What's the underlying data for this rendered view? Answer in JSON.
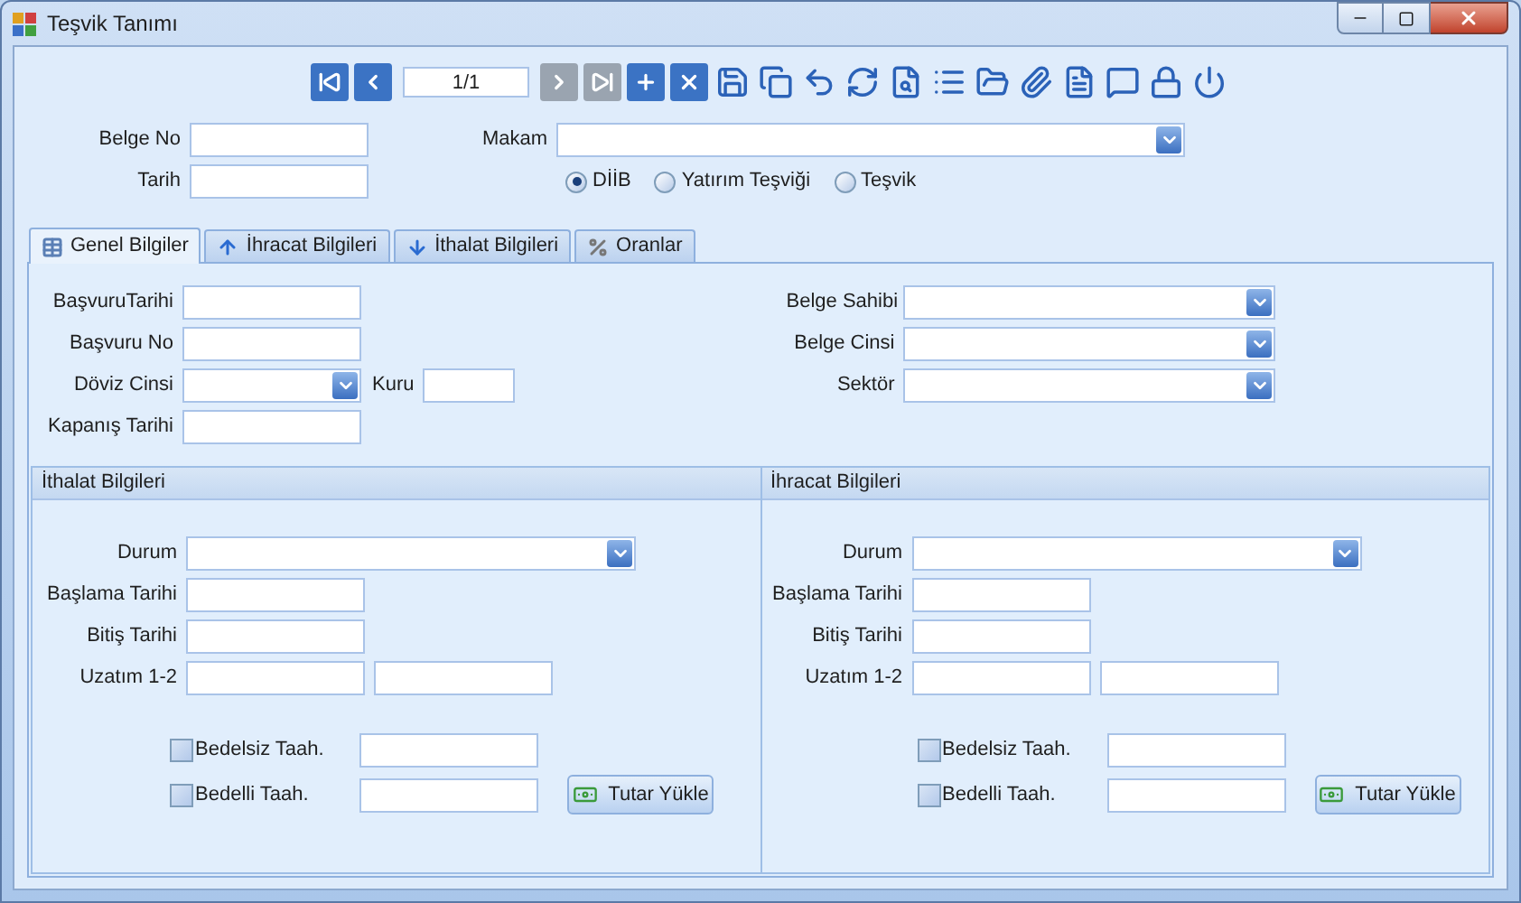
{
  "window": {
    "title": "Teşvik Tanımı"
  },
  "toolbar": {
    "page": "1/1",
    "buttons": [
      {
        "kind": "first",
        "disabled": false
      },
      {
        "kind": "prev",
        "disabled": false
      },
      {
        "kind": "pager",
        "disabled": false
      },
      {
        "kind": "next",
        "disabled": true
      },
      {
        "kind": "last",
        "disabled": true
      },
      {
        "kind": "add",
        "disabled": false
      },
      {
        "kind": "delete",
        "disabled": false
      },
      {
        "kind": "save",
        "disabled": false
      },
      {
        "kind": "saveas",
        "disabled": false
      },
      {
        "kind": "undo",
        "disabled": false
      },
      {
        "kind": "refresh",
        "disabled": false
      },
      {
        "kind": "preview",
        "disabled": false
      },
      {
        "kind": "list",
        "disabled": false
      },
      {
        "kind": "folder",
        "disabled": false
      },
      {
        "kind": "attach",
        "disabled": false
      },
      {
        "kind": "report",
        "disabled": false
      },
      {
        "kind": "comment",
        "disabled": false
      },
      {
        "kind": "lock",
        "disabled": false
      },
      {
        "kind": "power",
        "disabled": false
      }
    ]
  },
  "header": {
    "belge_no": "Belge No",
    "tarih": "Tarih",
    "makam": "Makam",
    "radios": [
      {
        "label": "DİİB",
        "selected": true
      },
      {
        "label": "Yatırım Teşviği",
        "selected": false
      },
      {
        "label": "Teşvik",
        "selected": false
      }
    ]
  },
  "tabs": [
    {
      "label": "Genel Bilgiler",
      "kind": "table",
      "selected": true
    },
    {
      "label": "İhracat Bilgileri",
      "kind": "up",
      "selected": false
    },
    {
      "label": "İthalat Bilgileri",
      "kind": "down",
      "selected": false
    },
    {
      "label": "Oranlar",
      "kind": "percent",
      "selected": false
    }
  ],
  "general": {
    "left": [
      {
        "label": "BaşvuruTarihi",
        "kind": "text"
      },
      {
        "label": "Başvuru No",
        "kind": "text"
      },
      {
        "label": "Döviz Cinsi",
        "kind": "combo",
        "extra": "Kuru"
      },
      {
        "label": "Kapanış Tarihi",
        "kind": "text"
      }
    ],
    "right": [
      {
        "label": "Belge Sahibi"
      },
      {
        "label": "Belge Cinsi"
      },
      {
        "label": "Sektör"
      }
    ]
  },
  "groups": [
    {
      "title": "İthalat Bilgileri",
      "durum": "Durum",
      "baslama": "Başlama Tarihi",
      "bitis": "Bitiş Tarihi",
      "uzatim": "Uzatım 1-2",
      "checks": [
        {
          "label": "Bedelsiz Taah.",
          "checked": false
        },
        {
          "label": "Bedelli Taah.",
          "checked": false
        }
      ],
      "button": "Tutar Yükle"
    },
    {
      "title": "İhracat Bilgileri",
      "durum": "Durum",
      "baslama": "Başlama Tarihi",
      "bitis": "Bitiş Tarihi",
      "uzatim": "Uzatım 1-2",
      "checks": [
        {
          "label": "Bedelsiz Taah.",
          "checked": false
        },
        {
          "label": "Bedelli Taah.",
          "checked": false
        }
      ],
      "button": "Tutar Yükle"
    }
  ]
}
